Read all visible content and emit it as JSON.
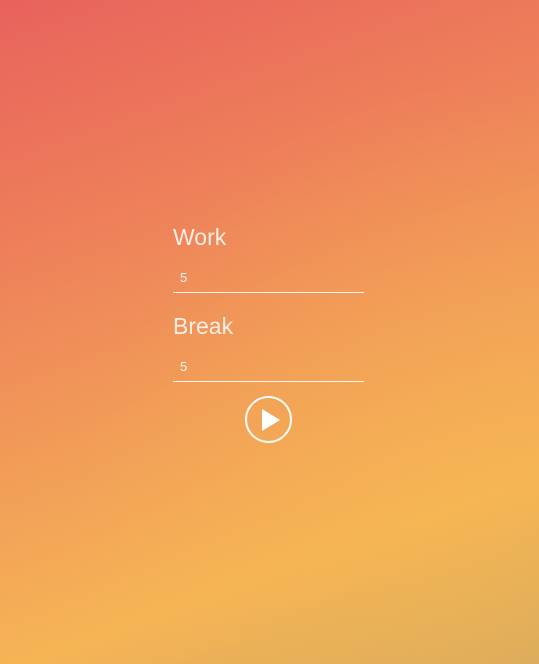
{
  "timer": {
    "work_label": "Work",
    "work_value": "5",
    "break_label": "Break",
    "break_value": "5",
    "start_icon": "play-icon"
  },
  "colors": {
    "gradient_top_left": "#e8625c",
    "gradient_bottom_right": "#f6b455",
    "foreground": "#ffffff"
  }
}
